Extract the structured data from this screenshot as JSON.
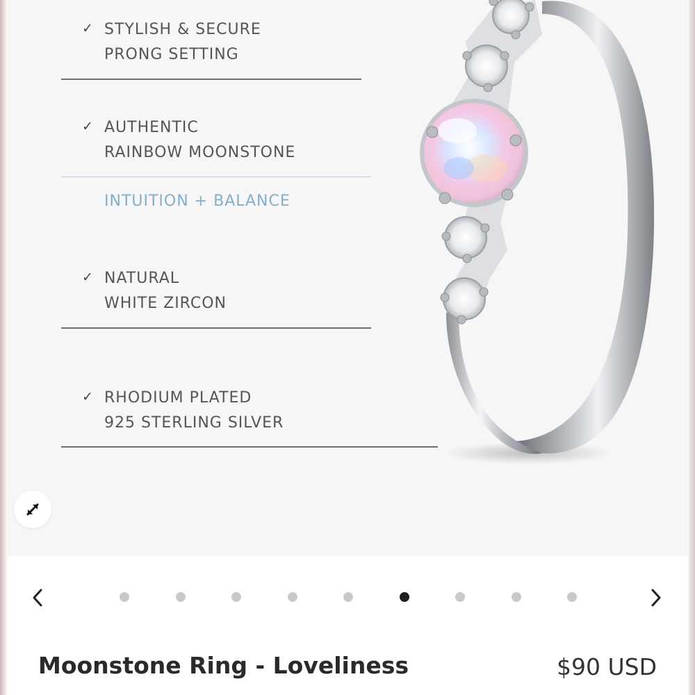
{
  "features": [
    {
      "line1": "STYLISH & SECURE",
      "line2": "PRONG SETTING"
    },
    {
      "line1": "AUTHENTIC",
      "line2": "RAINBOW MOONSTONE"
    },
    {
      "line1": "NATURAL",
      "line2": "WHITE ZIRCON"
    },
    {
      "line1": "RHODIUM PLATED",
      "line2": "925 STERLING SILVER"
    }
  ],
  "check_mark": "✓",
  "stone_meaning": "INTUITION + BALANCE",
  "icons": {
    "expand": "expand-arrows-icon",
    "prev": "chevron-left-icon",
    "next": "chevron-right-icon"
  },
  "carousel": {
    "total_slides": 9,
    "active_index": 5
  },
  "product": {
    "title": "Moonstone Ring - Loveliness",
    "price": "$90 USD"
  },
  "colors": {
    "meaning_text": "#86aec9",
    "active_dot": "#1e1e1e",
    "inactive_dot": "#c9c9c9"
  }
}
